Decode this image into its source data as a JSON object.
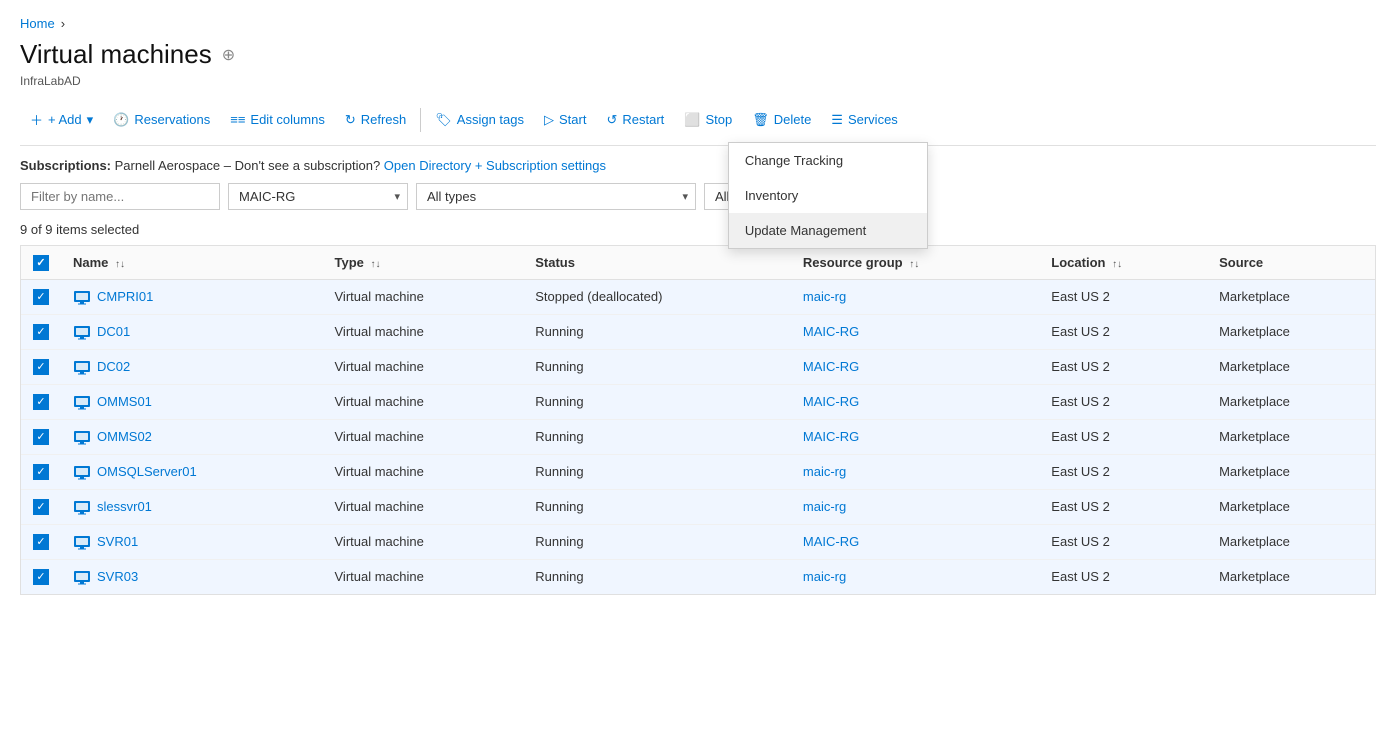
{
  "breadcrumb": {
    "home": "Home"
  },
  "header": {
    "title": "Virtual machines",
    "subtitle": "InfraLabAD",
    "pin_icon": "📌"
  },
  "toolbar": {
    "add_label": "+ Add",
    "add_chevron": "▾",
    "reservations_label": "Reservations",
    "edit_columns_label": "Edit columns",
    "refresh_label": "Refresh",
    "assign_tags_label": "Assign tags",
    "start_label": "Start",
    "restart_label": "Restart",
    "stop_label": "Stop",
    "delete_label": "Delete",
    "services_label": "Services"
  },
  "subscriptions": {
    "label": "Subscriptions:",
    "text": "Parnell Aerospace – Don't see a subscription?",
    "link": "Open Directory + Subscription settings"
  },
  "filters": {
    "name_placeholder": "Filter by name...",
    "resource_group": "MAIC-RG",
    "all_types": "All types",
    "all_locations": "All locations"
  },
  "items_count": "9 of 9 items selected",
  "table": {
    "columns": [
      {
        "key": "name",
        "label": "Name",
        "sortable": true
      },
      {
        "key": "type",
        "label": "Type",
        "sortable": true
      },
      {
        "key": "status",
        "label": "Status",
        "sortable": false
      },
      {
        "key": "resource_group",
        "label": "Resource group",
        "sortable": true
      },
      {
        "key": "location",
        "label": "Location",
        "sortable": true
      },
      {
        "key": "source",
        "label": "Source",
        "sortable": false
      }
    ],
    "rows": [
      {
        "name": "CMPRI01",
        "type": "Virtual machine",
        "status": "Stopped (deallocated)",
        "resource_group": "maic-rg",
        "resource_group_link": true,
        "location": "East US 2",
        "source": "Marketplace"
      },
      {
        "name": "DC01",
        "type": "Virtual machine",
        "status": "Running",
        "resource_group": "MAIC-RG",
        "resource_group_link": true,
        "location": "East US 2",
        "source": "Marketplace"
      },
      {
        "name": "DC02",
        "type": "Virtual machine",
        "status": "Running",
        "resource_group": "MAIC-RG",
        "resource_group_link": true,
        "location": "East US 2",
        "source": "Marketplace"
      },
      {
        "name": "OMMS01",
        "type": "Virtual machine",
        "status": "Running",
        "resource_group": "MAIC-RG",
        "resource_group_link": true,
        "location": "East US 2",
        "source": "Marketplace"
      },
      {
        "name": "OMMS02",
        "type": "Virtual machine",
        "status": "Running",
        "resource_group": "MAIC-RG",
        "resource_group_link": true,
        "location": "East US 2",
        "source": "Marketplace"
      },
      {
        "name": "OMSQLServer01",
        "type": "Virtual machine",
        "status": "Running",
        "resource_group": "maic-rg",
        "resource_group_link": true,
        "location": "East US 2",
        "source": "Marketplace"
      },
      {
        "name": "slessvr01",
        "type": "Virtual machine",
        "status": "Running",
        "resource_group": "maic-rg",
        "resource_group_link": true,
        "location": "East US 2",
        "source": "Marketplace"
      },
      {
        "name": "SVR01",
        "type": "Virtual machine",
        "status": "Running",
        "resource_group": "MAIC-RG",
        "resource_group_link": true,
        "location": "East US 2",
        "source": "Marketplace"
      },
      {
        "name": "SVR03",
        "type": "Virtual machine",
        "status": "Running",
        "resource_group": "maic-rg",
        "resource_group_link": true,
        "location": "East US 2",
        "source": "Marketplace"
      }
    ]
  },
  "services_dropdown": {
    "items": [
      {
        "label": "Change Tracking"
      },
      {
        "label": "Inventory"
      },
      {
        "label": "Update Management"
      }
    ]
  },
  "colors": {
    "accent": "#0078d4",
    "highlight_bg": "#f0f0f0"
  }
}
